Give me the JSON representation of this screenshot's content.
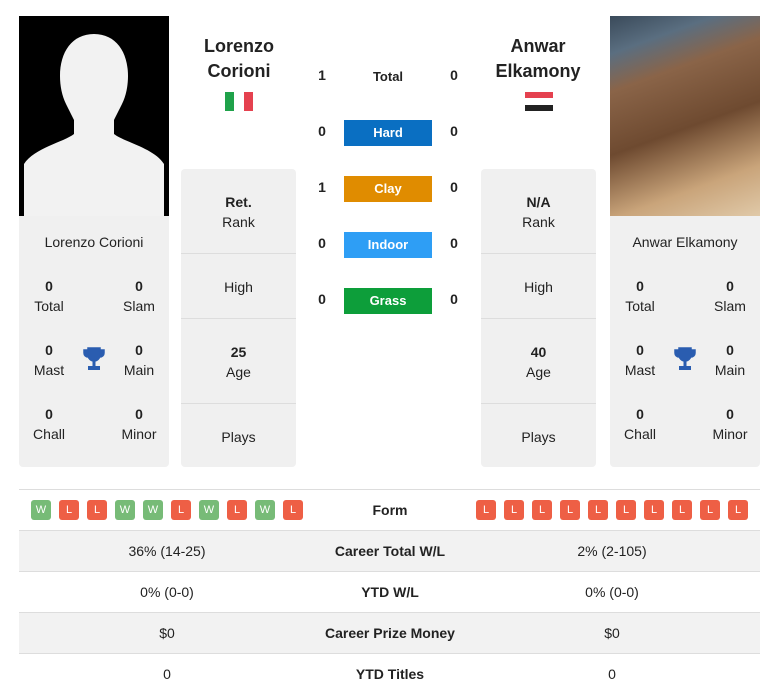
{
  "player1": {
    "name": "Lorenzo Corioni",
    "name_line1": "Lorenzo",
    "name_line2": "Corioni",
    "flag": "italy",
    "total": "0",
    "total_label": "Total",
    "slam": "0",
    "slam_label": "Slam",
    "mast": "0",
    "mast_label": "Mast",
    "main": "0",
    "main_label": "Main",
    "chall": "0",
    "chall_label": "Chall",
    "minor": "0",
    "minor_label": "Minor",
    "rank": "Ret.",
    "rank_label": "Rank",
    "high_label": "High",
    "age": "25",
    "age_label": "Age",
    "plays_label": "Plays",
    "form": [
      "W",
      "L",
      "L",
      "W",
      "W",
      "L",
      "W",
      "L",
      "W",
      "L"
    ],
    "career_wl": "36% (14-25)",
    "ytd_wl": "0% (0-0)",
    "prize": "$0",
    "ytd_titles": "0"
  },
  "player2": {
    "name": "Anwar Elkamony",
    "name_line1": "Anwar",
    "name_line2": "Elkamony",
    "flag": "egypt",
    "total": "0",
    "total_label": "Total",
    "slam": "0",
    "slam_label": "Slam",
    "mast": "0",
    "mast_label": "Mast",
    "main": "0",
    "main_label": "Main",
    "chall": "0",
    "chall_label": "Chall",
    "minor": "0",
    "minor_label": "Minor",
    "rank": "N/A",
    "rank_label": "Rank",
    "high_label": "High",
    "age": "40",
    "age_label": "Age",
    "plays_label": "Plays",
    "form": [
      "L",
      "L",
      "L",
      "L",
      "L",
      "L",
      "L",
      "L",
      "L",
      "L"
    ],
    "career_wl": "2% (2-105)",
    "ytd_wl": "0% (0-0)",
    "prize": "$0",
    "ytd_titles": "0"
  },
  "h2h": [
    {
      "label": "Total",
      "p1": "1",
      "p2": "0",
      "color": ""
    },
    {
      "label": "Hard",
      "p1": "0",
      "p2": "0",
      "color": "#0a6fc2"
    },
    {
      "label": "Clay",
      "p1": "1",
      "p2": "0",
      "color": "#e08c00"
    },
    {
      "label": "Indoor",
      "p1": "0",
      "p2": "0",
      "color": "#2e9ef5"
    },
    {
      "label": "Grass",
      "p1": "0",
      "p2": "0",
      "color": "#0d9e3a"
    }
  ],
  "table": {
    "form": "Form",
    "career_wl": "Career Total W/L",
    "ytd_wl": "YTD W/L",
    "prize": "Career Prize Money",
    "ytd_titles": "YTD Titles"
  },
  "colors": {
    "win": "#77bb77",
    "loss": "#ee5f45"
  }
}
